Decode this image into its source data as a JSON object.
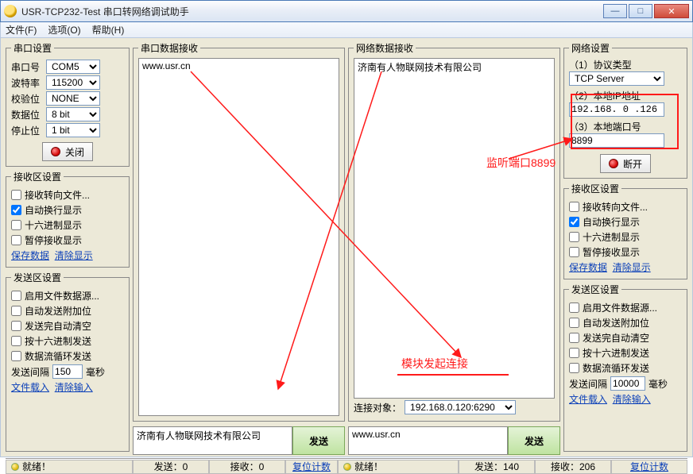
{
  "window": {
    "title": "USR-TCP232-Test 串口转网络调试助手"
  },
  "menu": {
    "file": "文件(F)",
    "options": "选项(O)",
    "help": "帮助(H)"
  },
  "serial": {
    "legend": "串口设置",
    "port_label": "串口号",
    "port": "COM5",
    "baud_label": "波特率",
    "baud": "115200",
    "parity_label": "校验位",
    "parity": "NONE",
    "databits_label": "数据位",
    "databits": "8 bit",
    "stopbits_label": "停止位",
    "stopbits": "1 bit",
    "close_btn": "关闭"
  },
  "rx_opts": {
    "legend": "接收区设置",
    "to_file": "接收转向文件...",
    "auto_wrap": "自动换行显示",
    "hex": "十六进制显示",
    "pause": "暂停接收显示",
    "save": "保存数据",
    "clear": "清除显示"
  },
  "tx_opts": {
    "legend": "发送区设置",
    "file_src": "启用文件数据源...",
    "auto_append": "自动发送附加位",
    "auto_clear": "发送完自动清空",
    "hex_send": "按十六进制发送",
    "loop": "数据流循环发送",
    "interval_label": "发送间隔",
    "interval_left": "150",
    "interval_right": "10000",
    "ms": "毫秒",
    "load_file": "文件载入",
    "clear_input": "清除输入"
  },
  "mid": {
    "serial_rx_legend": "串口数据接收",
    "net_rx_legend": "网络数据接收",
    "serial_rx_text": "www.usr.cn",
    "net_rx_text": "济南有人物联网技术有限公司",
    "conn_target_label": "连接对象：",
    "conn_target": "192.168.0.120:6290",
    "serial_tx_text": "济南有人物联网技术有限公司",
    "net_tx_text": "www.usr.cn",
    "send_btn": "发送"
  },
  "net": {
    "legend": "网络设置",
    "proto_label": "（1）协议类型",
    "proto": "TCP Server",
    "ip_label": "（2）本地IP地址",
    "ip": "192.168. 0 .126",
    "port_label": "（3）本地端口号",
    "port": "8899",
    "disconnect_btn": "断开"
  },
  "status": {
    "ready": "就绪！",
    "send_l_label": "发送：",
    "send_l": "0",
    "recv_l_label": "接收：",
    "recv_l": "0",
    "reset": "复位计数",
    "send_r_label": "发送：",
    "send_r": "140",
    "recv_r_label": "接收：",
    "recv_r": "206"
  },
  "ann": {
    "conn_note": "模块发起连接",
    "listen_note": "监听端口8899"
  }
}
